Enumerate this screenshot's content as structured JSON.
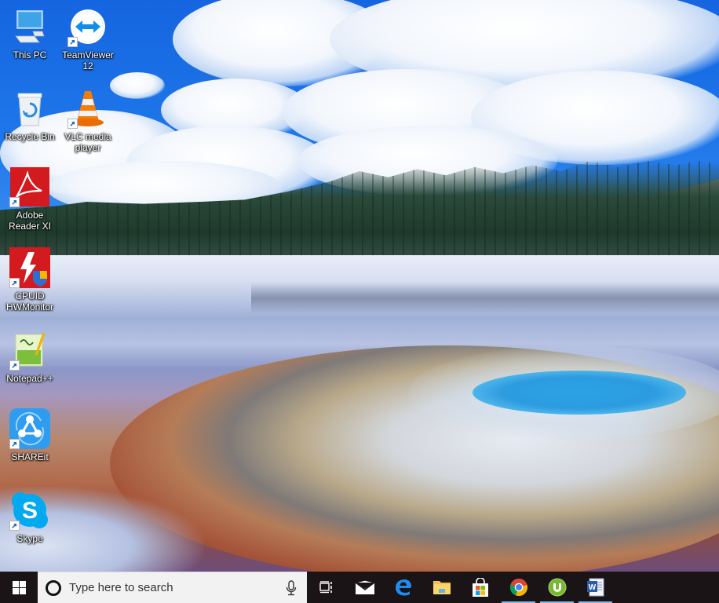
{
  "desktop": {
    "icons": [
      {
        "id": "this-pc",
        "label": "This PC",
        "icon": "computer-icon",
        "shortcut": false
      },
      {
        "id": "teamviewer",
        "label": "TeamViewer 12",
        "icon": "teamviewer-icon",
        "shortcut": true
      },
      {
        "id": "recycle-bin",
        "label": "Recycle Bin",
        "icon": "recycle-bin-icon",
        "shortcut": false
      },
      {
        "id": "vlc",
        "label": "VLC media player",
        "icon": "vlc-cone-icon",
        "shortcut": true
      },
      {
        "id": "adobe-reader",
        "label": "Adobe Reader XI",
        "icon": "adobe-reader-icon",
        "shortcut": true
      },
      {
        "id": "hwmonitor",
        "label": "CPUID HWMonitor",
        "icon": "hwmonitor-icon",
        "shortcut": true
      },
      {
        "id": "notepadpp",
        "label": "Notepad++",
        "icon": "notepadpp-icon",
        "shortcut": true
      },
      {
        "id": "shareit",
        "label": "SHAREit",
        "icon": "shareit-icon",
        "shortcut": true
      },
      {
        "id": "skype",
        "label": "Skype",
        "icon": "skype-icon",
        "shortcut": true
      }
    ]
  },
  "taskbar": {
    "start_icon": "windows-logo-icon",
    "search": {
      "placeholder": "Type here to search",
      "cortana_icon": "cortana-circle-icon",
      "mic_icon": "microphone-icon"
    },
    "task_view_icon": "task-view-icon",
    "pinned": [
      {
        "id": "mail",
        "icon": "mail-icon",
        "running": false
      },
      {
        "id": "edge",
        "icon": "edge-icon",
        "running": false
      },
      {
        "id": "file-explorer",
        "icon": "folder-icon",
        "running": false
      },
      {
        "id": "store",
        "icon": "store-bag-icon",
        "running": false
      },
      {
        "id": "chrome",
        "icon": "chrome-icon",
        "running": true
      },
      {
        "id": "utorrent",
        "icon": "utorrent-icon",
        "running": true
      },
      {
        "id": "word",
        "icon": "word-icon",
        "running": true
      }
    ],
    "colors": {
      "background": "#1b1416",
      "running_indicator": "#8ab8e6",
      "search_bg": "#f2f2f2"
    }
  }
}
